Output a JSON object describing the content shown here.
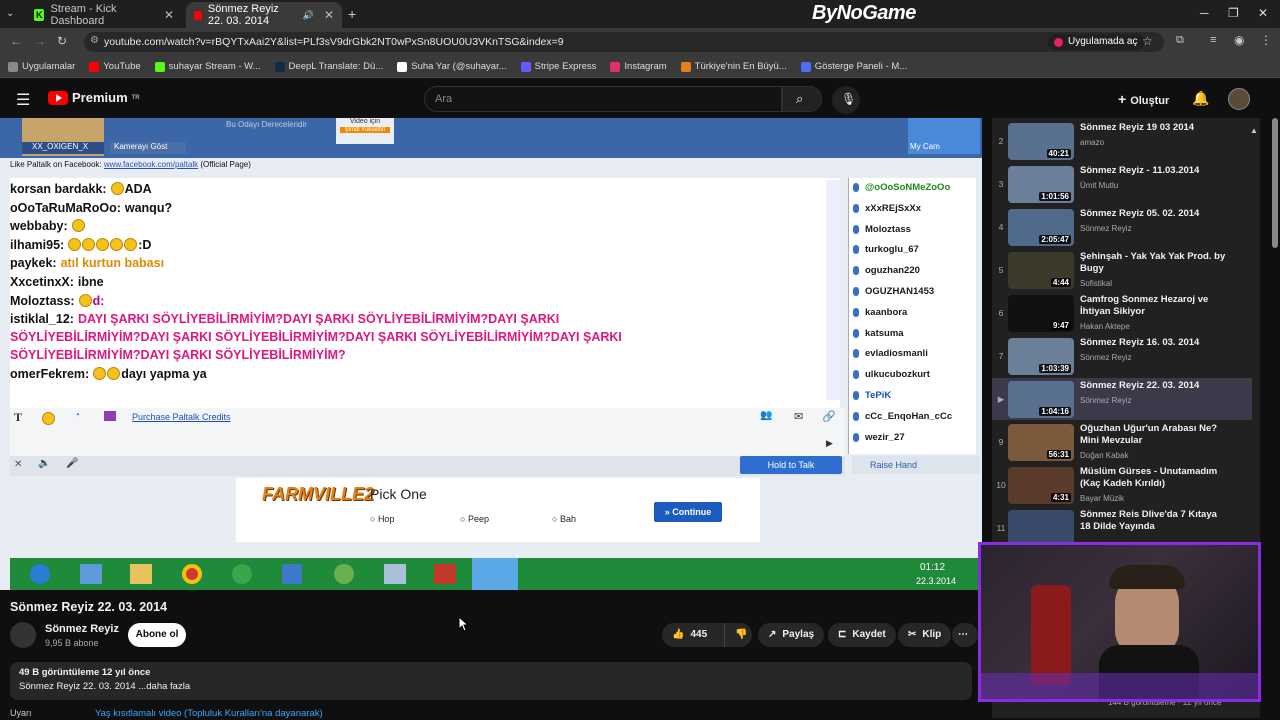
{
  "tabs": [
    {
      "label": "Stream - Kick Dashboard",
      "icon": "kick-icon"
    },
    {
      "label": "Sönmez Reyiz 22. 03. 2014",
      "icon": "youtube-icon"
    }
  ],
  "brand": "ByNoGame",
  "url": "youtube.com/watch?v=rBQYTxAai2Y&list=PLf3sV9drGbk2NT0wPxSn8UOU0U3VKnTSG&index=9",
  "open_in_app": "Uygulamada aç",
  "bookmarks": [
    "Uygulamalar",
    "YouTube",
    "suhayar Stream - W...",
    "DeepL Translate: Dü...",
    "Suha Yar (@suhayar...",
    "Stripe Express",
    "Instagram",
    "Türkiye'nin En Büyü...",
    "Gösterge Paneli - M..."
  ],
  "bookmark_colors": [
    "#888",
    "#f00",
    "#53fc18",
    "#0f2b46",
    "#fff",
    "#635bff",
    "#e1306c",
    "#e67e22",
    "#4c6ef5"
  ],
  "yt": {
    "premium": "Premium",
    "tr": "TR",
    "search_placeholder": "Ara",
    "create": "Oluştur"
  },
  "video_content": {
    "top_labels": [
      "XX_OXIGEN_X",
      "Kamerayı Göst",
      "Bu Odayı Derecelendir",
      "Video için",
      "Şimdi Yükseltin",
      "My Cam"
    ],
    "fb_line": "Like Paltalk on Facebook:",
    "fb_link": "www.facebook.com/paltalk",
    "fb_tail": "(Official Page)",
    "chat": [
      {
        "user": "korsan bardakk:",
        "text": "ADA",
        "emojis": 1,
        "color": "#111"
      },
      {
        "user": "oOoTaRuMaRoOo:",
        "text": "wanqu?",
        "emojis": 0,
        "color": "#111"
      },
      {
        "user": "webbaby:",
        "text": "",
        "emojis": 1,
        "color": "#2aa52a"
      },
      {
        "user": "ilhami95:",
        "text": ":D",
        "emojis": 5,
        "color": "#111"
      },
      {
        "user": "paykek:",
        "text": "atıl kurtun babası",
        "emojis": 0,
        "color": "#e08a00"
      },
      {
        "user": "XxcetinxX:",
        "text": "ibne",
        "emojis": 0,
        "color": "#111"
      },
      {
        "user": "Moloztass:",
        "text": "d:",
        "emojis": 1,
        "color": "#b0008a"
      },
      {
        "user": "istiklal_12:",
        "text": "DAYI ŞARKI SÖYLİYEBİLİRMİYİM?DAYI ŞARKI SÖYLİYEBİLİRMİYİM?DAYI ŞARKI",
        "emojis": 0,
        "color": "#e0177f"
      },
      {
        "user": "",
        "text": "SÖYLİYEBİLİRMİYİM?DAYI ŞARKI SÖYLİYEBİLİRMİYİM?DAYI ŞARKI SÖYLİYEBİLİRMİYİM?DAYI ŞARKI",
        "emojis": 0,
        "color": "#e0177f"
      },
      {
        "user": "",
        "text": "SÖYLİYEBİLİRMİYİM?DAYI ŞARKI SÖYLİYEBİLİRMİYİM?",
        "emojis": 0,
        "color": "#e0177f"
      },
      {
        "user": "omerFekrem:",
        "text": "dayı yapma ya",
        "emojis": 2,
        "color": "#111"
      }
    ],
    "users": [
      "@oOoSoNMeZoOo",
      "xXxREjSxXx",
      "Moloztass",
      "turkoglu_67",
      "oguzhan220",
      "OGUZHAN1453",
      "kaanbora",
      "katsuma",
      "evladiosmanli",
      "ulkucubozkurt",
      "TePiK",
      "cCc_EnqoHan_cCc",
      "wezir_27"
    ],
    "purchase": "Purchase Paltalk Credits",
    "hold_to_talk": "Hold to Talk",
    "raise_hand": "Raise Hand",
    "ad": {
      "title": "Pick One",
      "options": [
        "Hop",
        "Peep",
        "Bah"
      ],
      "continue": "Continue",
      "logo": "FARMVILLE2"
    },
    "clock": {
      "time": "01:12",
      "date": "22.3.2014"
    }
  },
  "video": {
    "title": "Sönmez Reyiz 22. 03. 2014",
    "channel": "Sönmez Reyiz",
    "subs": "9,95 B abone",
    "subscribe": "Abone ol",
    "likes": "445",
    "share": "Paylaş",
    "save": "Kaydet",
    "clip": "Klip",
    "views": "49 B görüntüleme  12 yıl önce",
    "desc": "Sönmez Reyiz 22. 03. 2014 ...daha fazla",
    "warning": "Uyarı",
    "warning_link": "Yaş kısıtlamalı video (Topluluk Kuralları'na dayanarak)"
  },
  "playlist": [
    {
      "n": "2",
      "title": "Sönmez Reyiz 19 03 2014",
      "ch": "amazo",
      "dur": "40:21"
    },
    {
      "n": "3",
      "title": "Sönmez Reyiz - 11.03.2014",
      "ch": "Ümit Mutlu",
      "dur": "1:01:56"
    },
    {
      "n": "4",
      "title": "Sönmez Reyiz 05. 02. 2014",
      "ch": "Sönmez Reyiz",
      "dur": "2:05:47"
    },
    {
      "n": "5",
      "title": "Şehinşah - Yak Yak Yak Prod. by Bugy",
      "ch": "Sofistikal",
      "dur": "4:44"
    },
    {
      "n": "6",
      "title": "Camfrog Sonmez Hezaroj ve İhtiyan Sikiyor",
      "ch": "Hakan Aktepe",
      "dur": "9:47"
    },
    {
      "n": "7",
      "title": "Sönmez Reyiz 16. 03. 2014",
      "ch": "Sönmez Reyiz",
      "dur": "1:03:39"
    },
    {
      "n": "▶",
      "title": "Sönmez Reyiz 22. 03. 2014",
      "ch": "Sönmez Reyiz",
      "dur": "1:04:16"
    },
    {
      "n": "9",
      "title": "Oğuzhan Uğur'un Arabası Ne? Mini Mevzular",
      "ch": "Doğan Kabak",
      "dur": "56:31"
    },
    {
      "n": "10",
      "title": "Müslüm Gürses - Unutamadım (Kaç Kadeh Kırıldı)",
      "ch": "Bayar Müzik",
      "dur": "4:31"
    },
    {
      "n": "11",
      "title": "Sönmez Reis Dlive'da 7 Kıtaya 18 Dilde Yayında",
      "ch": "",
      "dur": ""
    }
  ],
  "playlist_footer": "144 B görüntüleme · 12 yıl önce"
}
